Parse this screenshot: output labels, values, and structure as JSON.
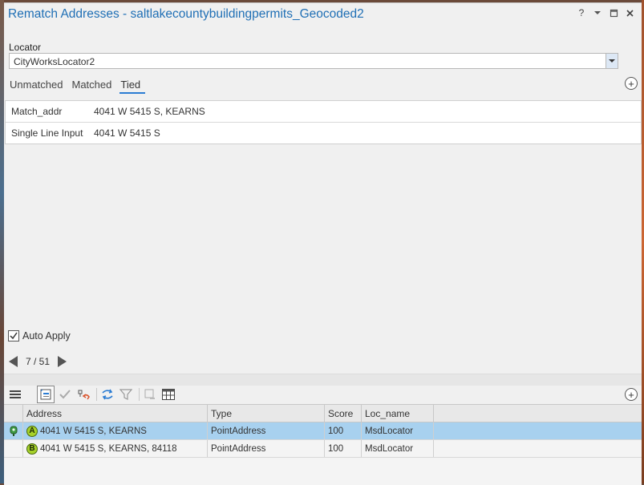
{
  "window": {
    "title": "Rematch Addresses - saltlakecountybuildingpermits_Geocoded2",
    "help": "?"
  },
  "locator": {
    "label": "Locator",
    "value": "CityWorksLocator2"
  },
  "tabs": [
    {
      "label": "Unmatched",
      "active": false
    },
    {
      "label": "Matched",
      "active": false
    },
    {
      "label": "Tied",
      "active": true
    }
  ],
  "attributes": [
    {
      "key": "Match_addr",
      "value": "4041 W 5415 S, KEARNS"
    },
    {
      "key": "Single Line Input",
      "value": "4041 W 5415 S"
    }
  ],
  "auto_apply": {
    "label": "Auto Apply",
    "checked": true
  },
  "pager": {
    "text": "7 / 51"
  },
  "candidates": {
    "columns": [
      "Address",
      "Type",
      "Score",
      "Loc_name"
    ],
    "rows": [
      {
        "marker": "A",
        "address": "4041 W 5415 S, KEARNS",
        "type": "PointAddress",
        "score": "100",
        "loc_name": "MsdLocator",
        "selected": true
      },
      {
        "marker": "B",
        "address": "4041 W 5415 S, KEARNS, 84118",
        "type": "PointAddress",
        "score": "100",
        "loc_name": "MsdLocator",
        "selected": false
      }
    ]
  },
  "colors": {
    "title": "#1f6fb5",
    "tab_underline": "#2b7cd3",
    "selected_row": "#a8d1ef",
    "marker_fill": "#a6d12a"
  }
}
